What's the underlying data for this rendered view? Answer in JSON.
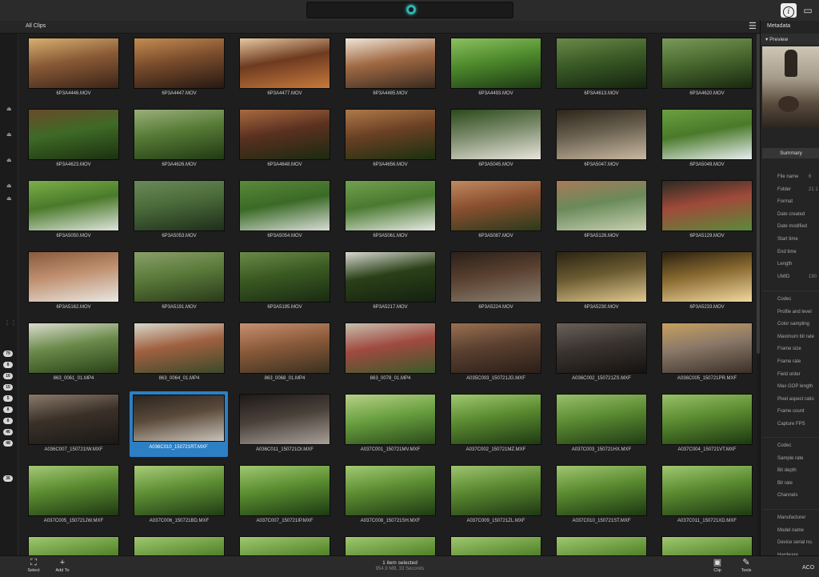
{
  "header": {
    "breadcrumb": "All Clips"
  },
  "right_panel": {
    "title": "Metadata",
    "preview_label": "Preview",
    "summary_label": "Summary",
    "fields_a": [
      {
        "label": "File name",
        "value": "6"
      },
      {
        "label": "Folder",
        "value": "21 1"
      },
      {
        "label": "Format",
        "value": ""
      },
      {
        "label": "Date created",
        "value": ""
      },
      {
        "label": "Date modified",
        "value": ""
      },
      {
        "label": "Start time",
        "value": ""
      },
      {
        "label": "End time",
        "value": ""
      },
      {
        "label": "Length",
        "value": ""
      },
      {
        "label": "UMID",
        "value": "190"
      }
    ],
    "fields_b": [
      {
        "label": "Codec",
        "value": ""
      },
      {
        "label": "Profile and level",
        "value": ""
      },
      {
        "label": "Color sampling",
        "value": ""
      },
      {
        "label": "Maximum bit rate",
        "value": ""
      },
      {
        "label": "Frame size",
        "value": ""
      },
      {
        "label": "Frame rate",
        "value": ""
      },
      {
        "label": "Field order",
        "value": ""
      },
      {
        "label": "Max GOP length",
        "value": ""
      },
      {
        "label": "Pixel aspect ratio",
        "value": ""
      },
      {
        "label": "Frame count",
        "value": ""
      },
      {
        "label": "Capture FPS",
        "value": ""
      }
    ],
    "fields_c": [
      {
        "label": "Codec",
        "value": ""
      },
      {
        "label": "Sample rate",
        "value": ""
      },
      {
        "label": "Bit depth",
        "value": ""
      },
      {
        "label": "Bit rate",
        "value": ""
      },
      {
        "label": "Channels",
        "value": ""
      }
    ],
    "fields_d": [
      {
        "label": "Manufacturer",
        "value": ""
      },
      {
        "label": "Model name",
        "value": ""
      },
      {
        "label": "Device serial no.",
        "value": ""
      },
      {
        "label": "Hardware",
        "value": ""
      }
    ]
  },
  "left_rail": {
    "badges": [
      "79",
      "8",
      "16",
      "15",
      "5",
      "8",
      "8",
      "46",
      "48",
      "36"
    ]
  },
  "clips": [
    {
      "name": "6P3A4446.MOV",
      "colors": [
        "#3a2418",
        "#8a5a36",
        "#d7b070"
      ]
    },
    {
      "name": "6P3A4447.MOV",
      "colors": [
        "#251912",
        "#7a4c2c",
        "#c48c52"
      ]
    },
    {
      "name": "6P3A4477.MOV",
      "colors": [
        "#c87b3c",
        "#6e3a20",
        "#e6c7a0"
      ]
    },
    {
      "name": "6P3A4485.MOV",
      "colors": [
        "#3a2a20",
        "#a06a44",
        "#efe6d8"
      ]
    },
    {
      "name": "6P3A4493.MOV",
      "colors": [
        "#1e3a14",
        "#4e8a2c",
        "#8cc060"
      ]
    },
    {
      "name": "6P3A4613.MOV",
      "colors": [
        "#14240e",
        "#3a5a26",
        "#6a8a4a"
      ]
    },
    {
      "name": "6P3A4620.MOV",
      "colors": [
        "#18280f",
        "#4a6a30",
        "#7a9a5a"
      ]
    },
    {
      "name": "6P3A4623.MOV",
      "colors": [
        "#1c3010",
        "#3e6a26",
        "#6a4a2a"
      ]
    },
    {
      "name": "6P3A4626.MOV",
      "colors": [
        "#203a14",
        "#567a36",
        "#9ab07a"
      ]
    },
    {
      "name": "6P3A4648.MOV",
      "colors": [
        "#1a2a10",
        "#5a3020",
        "#a86a40"
      ]
    },
    {
      "name": "6P3A4656.MOV",
      "colors": [
        "#1a3010",
        "#6a4024",
        "#b07a4a"
      ]
    },
    {
      "name": "6P3A5045.MOV",
      "colors": [
        "#e8e4dc",
        "#7a8a6a",
        "#2a4a1a"
      ]
    },
    {
      "name": "6P3A5047.MOV",
      "colors": [
        "#c8b8a0",
        "#6a6050",
        "#2a2418"
      ]
    },
    {
      "name": "6P3A5049.MOV",
      "colors": [
        "#e8eef0",
        "#4a7a2a",
        "#6aa040"
      ]
    },
    {
      "name": "6P3A5050.MOV",
      "colors": [
        "#dfe4dc",
        "#4a7a2a",
        "#7ab04a"
      ]
    },
    {
      "name": "6P3A5053.MOV",
      "colors": [
        "#1e2e1a",
        "#4a6a3a",
        "#6a8a5a"
      ]
    },
    {
      "name": "6P3A5054.MOV",
      "colors": [
        "#d8dcd6",
        "#3a6a26",
        "#5a8a3a"
      ]
    },
    {
      "name": "6P3A5061.MOV",
      "colors": [
        "#e6e8e4",
        "#4a7a30",
        "#72a050"
      ]
    },
    {
      "name": "6P3A5087.MOV",
      "colors": [
        "#2a3a1a",
        "#8a5030",
        "#c08a60"
      ]
    },
    {
      "name": "6P3A5126.MOV",
      "colors": [
        "#c8d0b0",
        "#6a8a5a",
        "#a87a5a"
      ]
    },
    {
      "name": "6P3A5129.MOV",
      "colors": [
        "#5a8a3a",
        "#a04a3a",
        "#2a2a22"
      ]
    },
    {
      "name": "6P3A5162.MOV",
      "colors": [
        "#e8e8e2",
        "#c09070",
        "#8a5a40"
      ]
    },
    {
      "name": "6P3A5191.MOV",
      "colors": [
        "#2a3a1a",
        "#5a7a3a",
        "#8aa06a"
      ]
    },
    {
      "name": "6P3A5195.MOV",
      "colors": [
        "#1a2a12",
        "#3a5a22",
        "#6a8a4a"
      ]
    },
    {
      "name": "6P3A5217.MOV",
      "colors": [
        "#142010",
        "#2a4018",
        "#d8d8d0"
      ]
    },
    {
      "name": "6P3A5224.MOV",
      "colors": [
        "#8a8070",
        "#5a4030",
        "#2a2018"
      ]
    },
    {
      "name": "6P3A5230.MOV",
      "colors": [
        "#e0c890",
        "#6a5a30",
        "#2a2414"
      ]
    },
    {
      "name": "6P3A5233.MOV",
      "colors": [
        "#f0d8a0",
        "#8a6a30",
        "#2a2010"
      ]
    },
    {
      "name": "863_0061_01.MP4",
      "colors": [
        "#2a4018",
        "#6a8a4a",
        "#dadcd0"
      ]
    },
    {
      "name": "863_0064_01.MP4",
      "colors": [
        "#3a4a2a",
        "#a06040",
        "#d8d8cc"
      ]
    },
    {
      "name": "863_0068_01.MP4",
      "colors": [
        "#3a3020",
        "#8a5a3a",
        "#c89070"
      ]
    },
    {
      "name": "863_0078_01.MP4",
      "colors": [
        "#3a5a2a",
        "#a04a40",
        "#c8c0b0"
      ]
    },
    {
      "name": "A035C003_150721JG.MXF",
      "colors": [
        "#2a1e18",
        "#5a4030",
        "#9a7050"
      ]
    },
    {
      "name": "A036C002_150721ZS.MXF",
      "colors": [
        "#141210",
        "#3a3430",
        "#6a6058"
      ]
    },
    {
      "name": "A036C005_150721PR.MXF",
      "colors": [
        "#3a3028",
        "#8a7868",
        "#c8a060"
      ]
    },
    {
      "name": "A036C007_150721IW.MXF",
      "colors": [
        "#1a1816",
        "#3a3028",
        "#8a7a6a"
      ]
    },
    {
      "name": "A036C010_150721RT.MXF",
      "colors": [
        "#c8c2b8",
        "#5a4a3a",
        "#2a2420"
      ],
      "selected": true
    },
    {
      "name": "A036C011_150721OI.MXF",
      "colors": [
        "#a8a098",
        "#4a403a",
        "#1e1a18"
      ]
    },
    {
      "name": "A037C001_150721MV.MXF",
      "colors": [
        "#2a4a18",
        "#6aa040",
        "#b8d088"
      ]
    },
    {
      "name": "A037C002_150721MZ.MXF",
      "colors": [
        "#1e3a12",
        "#5a8a30",
        "#a0c870"
      ]
    },
    {
      "name": "A037C003_150721HX.MXF",
      "colors": [
        "#203c14",
        "#5a8a32",
        "#98c06a"
      ]
    },
    {
      "name": "A037C004_150721VT.MXF",
      "colors": [
        "#1c3810",
        "#5a8a30",
        "#98c068"
      ]
    },
    {
      "name": "A037C005_150721JW.MXF",
      "colors": [
        "#1e3812",
        "#5a8a30",
        "#a4c874"
      ]
    },
    {
      "name": "A037C006_150721BD.MXF",
      "colors": [
        "#203c14",
        "#5e8e34",
        "#a8cc78"
      ]
    },
    {
      "name": "A037C007_150721IP.MXF",
      "colors": [
        "#1c3a12",
        "#5a8c30",
        "#a0c870"
      ]
    },
    {
      "name": "A037C008_150721SH.MXF",
      "colors": [
        "#1e3a12",
        "#5c8c32",
        "#a2ca72"
      ]
    },
    {
      "name": "A037C009_150721ZL.MXF",
      "colors": [
        "#1e3812",
        "#5a8830",
        "#9ec46e"
      ]
    },
    {
      "name": "A037C010_150721ST.MXF",
      "colors": [
        "#1c3810",
        "#5a8a30",
        "#a0c670"
      ]
    },
    {
      "name": "A037C011_150721XD.MXF",
      "colors": [
        "#1e3a12",
        "#5a8a30",
        "#a0c870"
      ]
    },
    {
      "name": "",
      "colors": [
        "#1e3a12",
        "#5a8a30",
        "#a0c870"
      ]
    },
    {
      "name": "",
      "colors": [
        "#1e3a12",
        "#5a8a30",
        "#a0c870"
      ]
    },
    {
      "name": "",
      "colors": [
        "#1e3a12",
        "#5a8a30",
        "#a0c870"
      ]
    },
    {
      "name": "",
      "colors": [
        "#1e3a12",
        "#5a8a30",
        "#a0c870"
      ]
    },
    {
      "name": "",
      "colors": [
        "#1e3a12",
        "#5a8a30",
        "#a0c870"
      ]
    },
    {
      "name": "",
      "colors": [
        "#1e3a12",
        "#5a8a30",
        "#a0c870"
      ]
    },
    {
      "name": "",
      "colors": [
        "#1e3a12",
        "#5a8a30",
        "#a0c870"
      ]
    }
  ],
  "bottom": {
    "select_label": "Select",
    "addto_label": "Add To",
    "status": "1 item selected",
    "status_detail": "954.9 MB, 33 Seconds",
    "clip_label": "Clip",
    "tools_label": "Tools",
    "aco_label": "ACO"
  }
}
